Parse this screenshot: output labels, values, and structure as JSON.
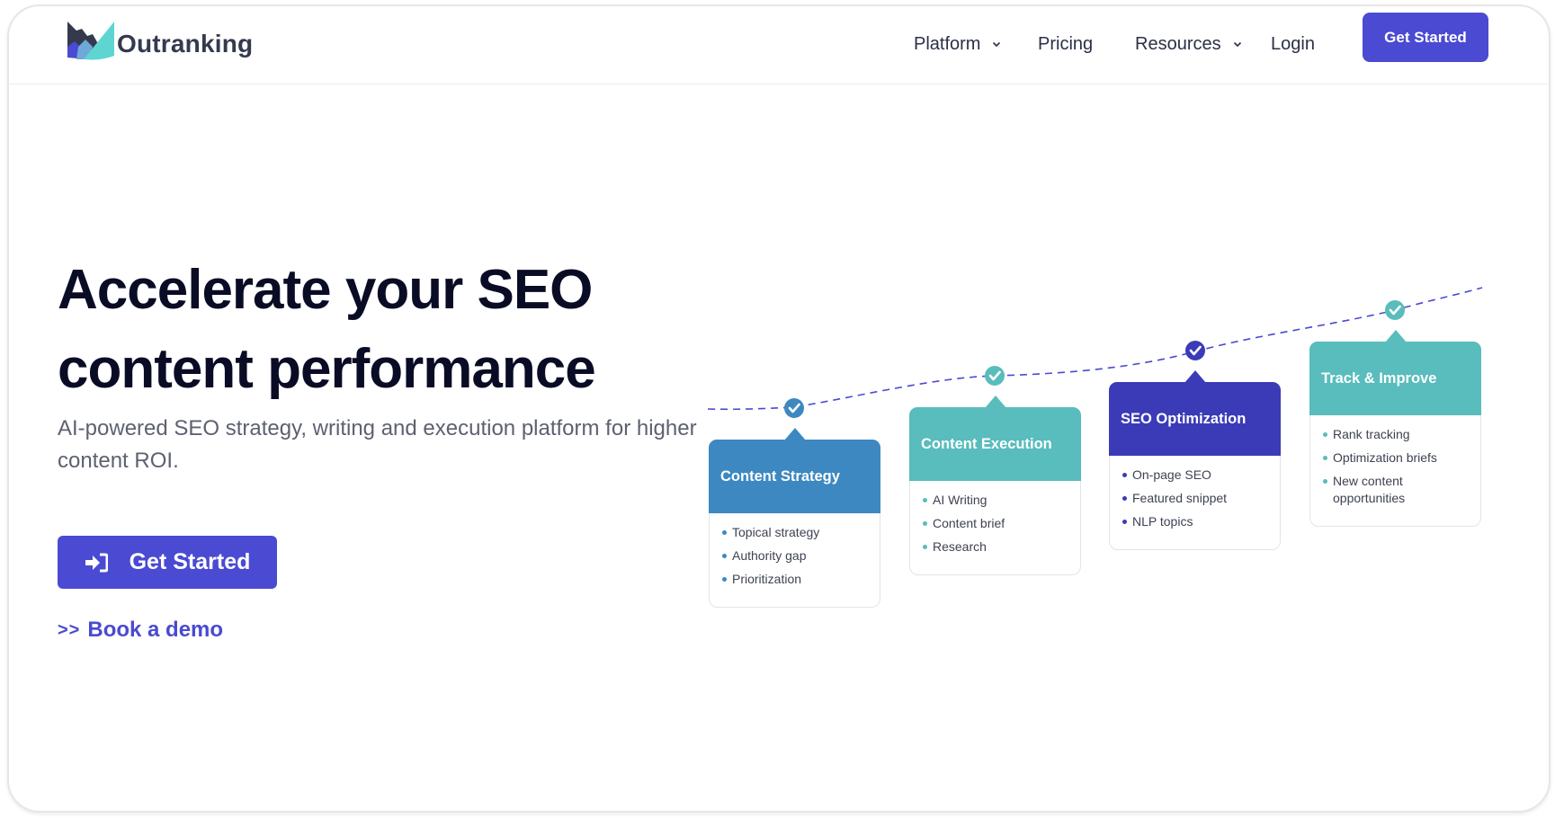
{
  "brand": {
    "name": "Outranking"
  },
  "nav": {
    "items": [
      {
        "label": "Platform",
        "has_dropdown": true
      },
      {
        "label": "Pricing",
        "has_dropdown": false
      },
      {
        "label": "Resources",
        "has_dropdown": true
      },
      {
        "label": "Login",
        "has_dropdown": false
      }
    ],
    "cta_label": "Get Started"
  },
  "hero": {
    "title_line1": "Accelerate your SEO",
    "title_line2": "content performance",
    "subtitle": "AI-powered SEO strategy, writing and execution platform for higher content ROI.",
    "primary_cta": {
      "label": "Get Started",
      "icon": "sign-in-icon"
    },
    "secondary_cta": {
      "prefix": ">>",
      "label": "Book a demo"
    }
  },
  "colors": {
    "accent": "#4a4ad2",
    "heading": "#0a0c26",
    "strategy_blue": "#3d88c0",
    "teal": "#58bdbc",
    "indigo": "#3b3bb8",
    "dashed_line": "#4a4ad2"
  },
  "roadmap": {
    "steps": [
      {
        "title": "Content Strategy",
        "color": "#3d88c0",
        "items": [
          "Topical strategy",
          "Authority gap",
          "Prioritization"
        ],
        "status": "completed"
      },
      {
        "title": "Content Execution",
        "color": "#58bdbc",
        "items": [
          "AI Writing",
          "Content brief",
          "Research"
        ],
        "status": "completed"
      },
      {
        "title": "SEO Optimization",
        "color": "#3b3bb8",
        "items": [
          "On-page SEO",
          "Featured snippet",
          "NLP topics"
        ],
        "status": "completed"
      },
      {
        "title": "Track & Improve",
        "color": "#58bdbc",
        "items": [
          "Rank tracking",
          "Optimization briefs",
          "New content opportunities"
        ],
        "status": "completed"
      }
    ]
  }
}
